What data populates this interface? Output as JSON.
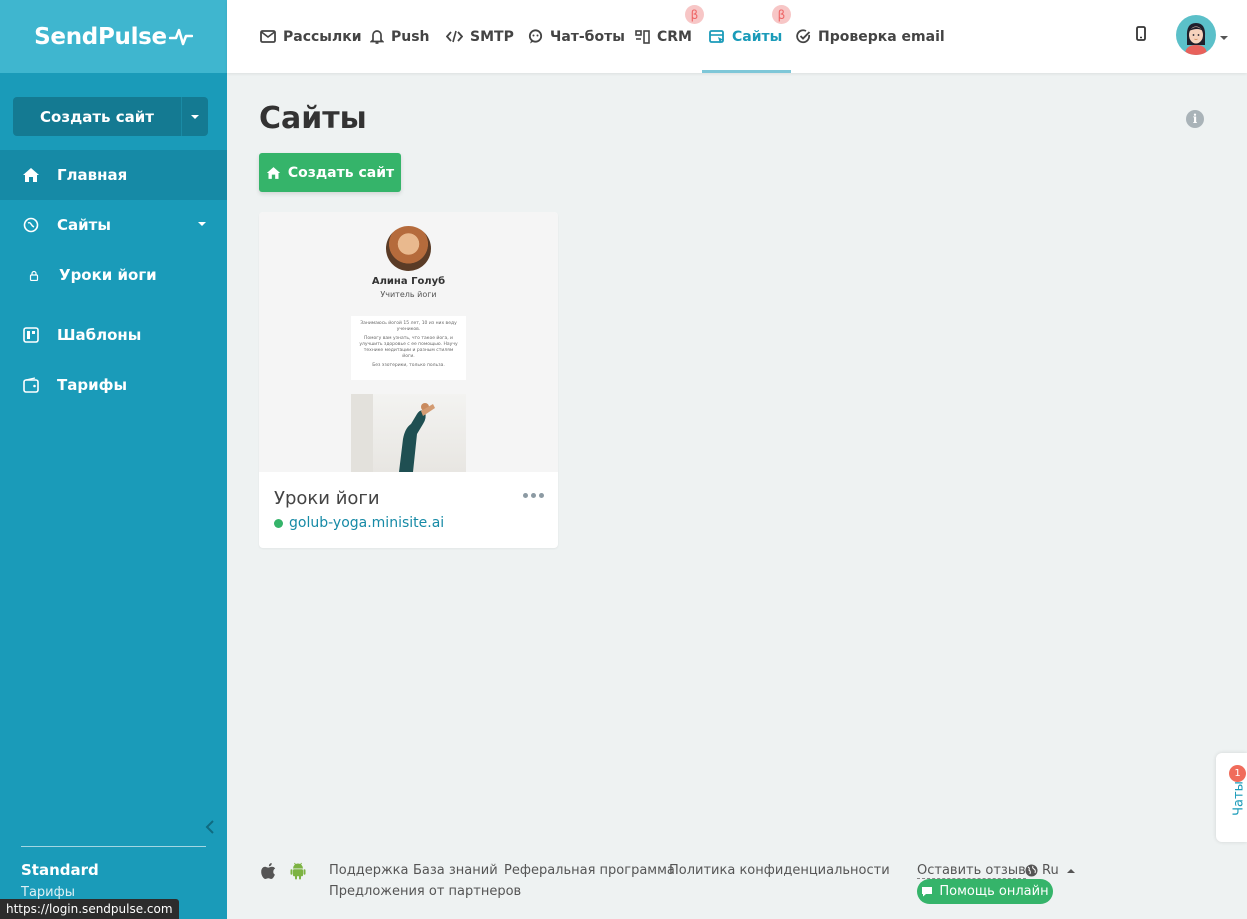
{
  "brand": {
    "logo_text": "SendPulse"
  },
  "sidebar": {
    "create_button_label": "Создать сайт",
    "items": [
      {
        "label": "Главная",
        "icon": "home-icon"
      },
      {
        "label": "Сайты",
        "icon": "sites-icon"
      },
      {
        "label": "Уроки йоги",
        "icon": "lock-icon"
      },
      {
        "label": "Шаблоны",
        "icon": "templates-icon"
      },
      {
        "label": "Тарифы",
        "icon": "wallet-icon"
      }
    ],
    "plan_name": "Standard",
    "plan_link": "Тарифы"
  },
  "topnav": {
    "items": [
      {
        "label": "Рассылки",
        "icon": "mail-icon"
      },
      {
        "label": "Push",
        "icon": "bell-icon"
      },
      {
        "label": "SMTP",
        "icon": "code-icon"
      },
      {
        "label": "Чат-боты",
        "icon": "chatbot-icon"
      },
      {
        "label": "CRM",
        "icon": "crm-icon",
        "badge": "β"
      },
      {
        "label": "Сайты",
        "icon": "sites-icon",
        "badge": "β"
      },
      {
        "label": "Проверка email",
        "icon": "check-circle-icon"
      }
    ]
  },
  "main": {
    "title": "Сайты",
    "create_button_label": "Создать сайт",
    "sites": [
      {
        "title": "Уроки йоги",
        "url": "golub-yoga.minisite.ai",
        "status_color": "#35b46a",
        "preview": {
          "name": "Алина Голуб",
          "role": "Учитель йоги",
          "text_lines": [
            "Занимаюсь йогой 15 лет, 10 из них веду учеников.",
            "Помогу вам узнать, что такое йога, и улучшить здоровье с ее помощью. Научу технике медитации и разным стилям йоги.",
            "Без эзотерики, только польза."
          ]
        }
      }
    ]
  },
  "footer": {
    "links": [
      "Поддержка",
      "База знаний",
      "Реферальная программа",
      "Политика конфиденциальности",
      "Предложения от партнеров"
    ],
    "feedback": "Оставить отзыв",
    "language": "Ru",
    "help_button": "Помощь онлайн"
  },
  "chats_tab": {
    "label": "Чаты",
    "badge": "1"
  },
  "status_bar": {
    "url": "https://login.sendpulse.com"
  },
  "colors": {
    "sidebar": "#1a9bb9",
    "accent": "#1a9bb9",
    "success": "#35b46a"
  }
}
